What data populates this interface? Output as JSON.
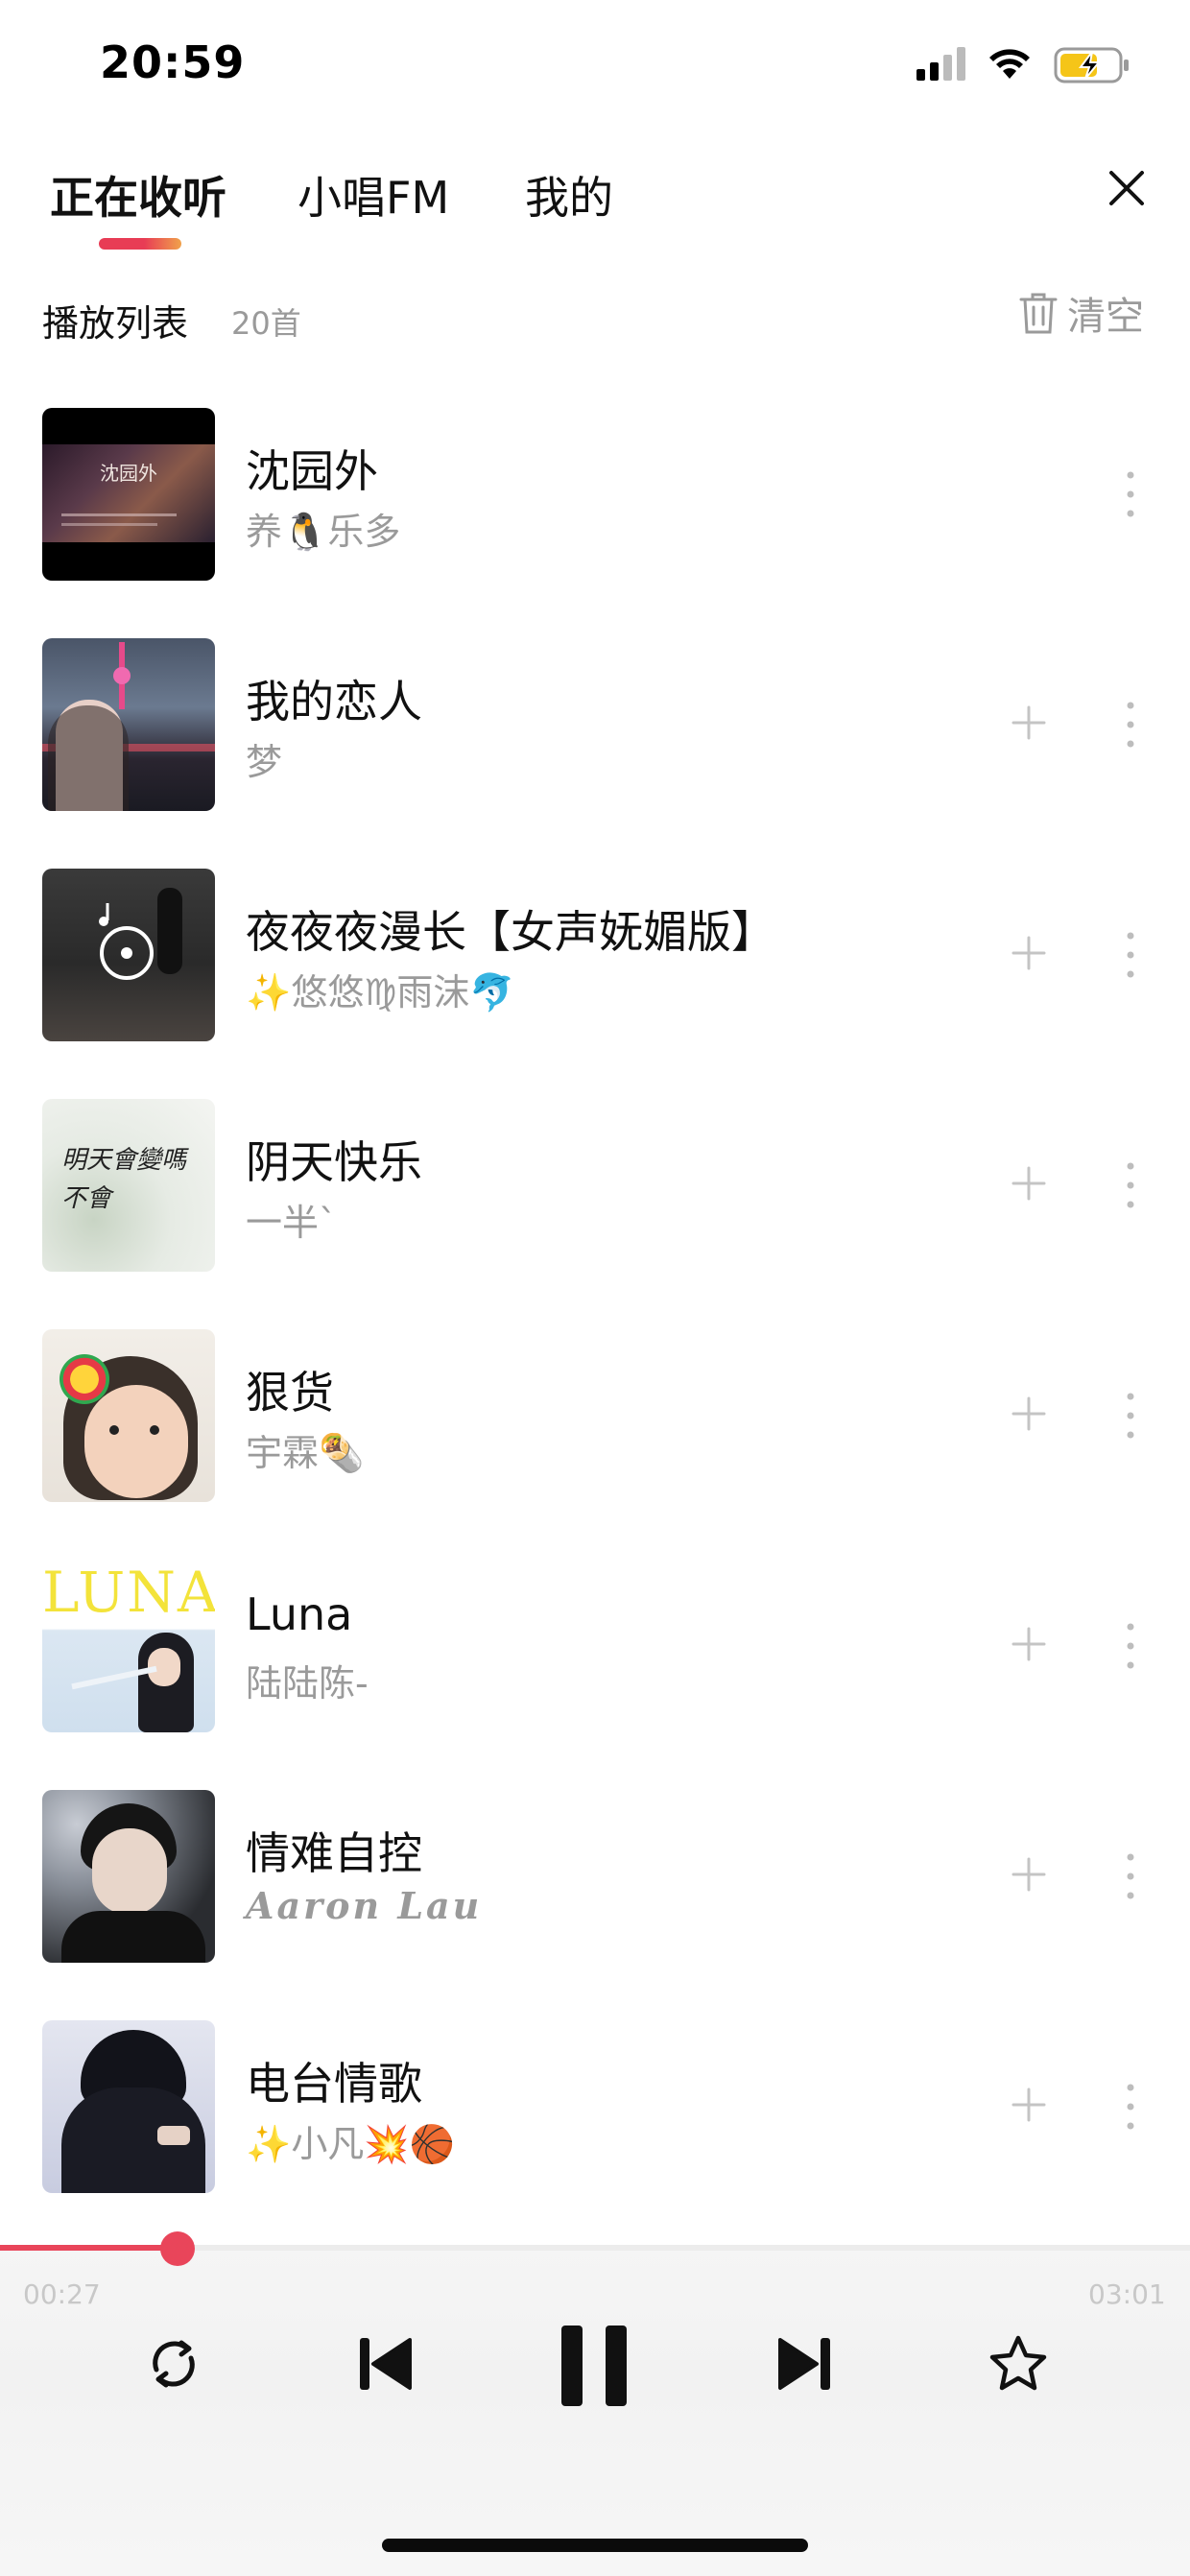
{
  "status_bar": {
    "time": "20:59"
  },
  "tabs": [
    {
      "label": "正在收听",
      "active": true
    },
    {
      "label": "小唱FM",
      "active": false
    },
    {
      "label": "我的",
      "active": false
    }
  ],
  "playlist": {
    "title": "播放列表",
    "count": "20首",
    "clear_label": "清空"
  },
  "songs": [
    {
      "title": "沈园外",
      "artist": "养🐧乐多",
      "cover_text": "沈园外"
    },
    {
      "title": "我的恋人",
      "artist": "梦"
    },
    {
      "title": "夜夜夜漫长【女声妩媚版】",
      "artist": "✨悠悠♍雨沫🐬"
    },
    {
      "title": "阴天快乐",
      "artist": "一半ˋ",
      "cover_text": "明天會變嗎 不會"
    },
    {
      "title": "狠货",
      "artist": "宇霖🌯"
    },
    {
      "title": "Luna",
      "artist": "陆陆陈-",
      "cover_text": "LUNA"
    },
    {
      "title": "情难自控",
      "artist": "Aaron  Lau"
    },
    {
      "title": "电台情歌",
      "artist": "✨小凡💥🏀"
    }
  ],
  "player": {
    "elapsed": "00:27",
    "duration": "03:01",
    "progress": 0.149
  },
  "colors": {
    "accent": "#e9455a",
    "muted": "#9a9a9a"
  }
}
